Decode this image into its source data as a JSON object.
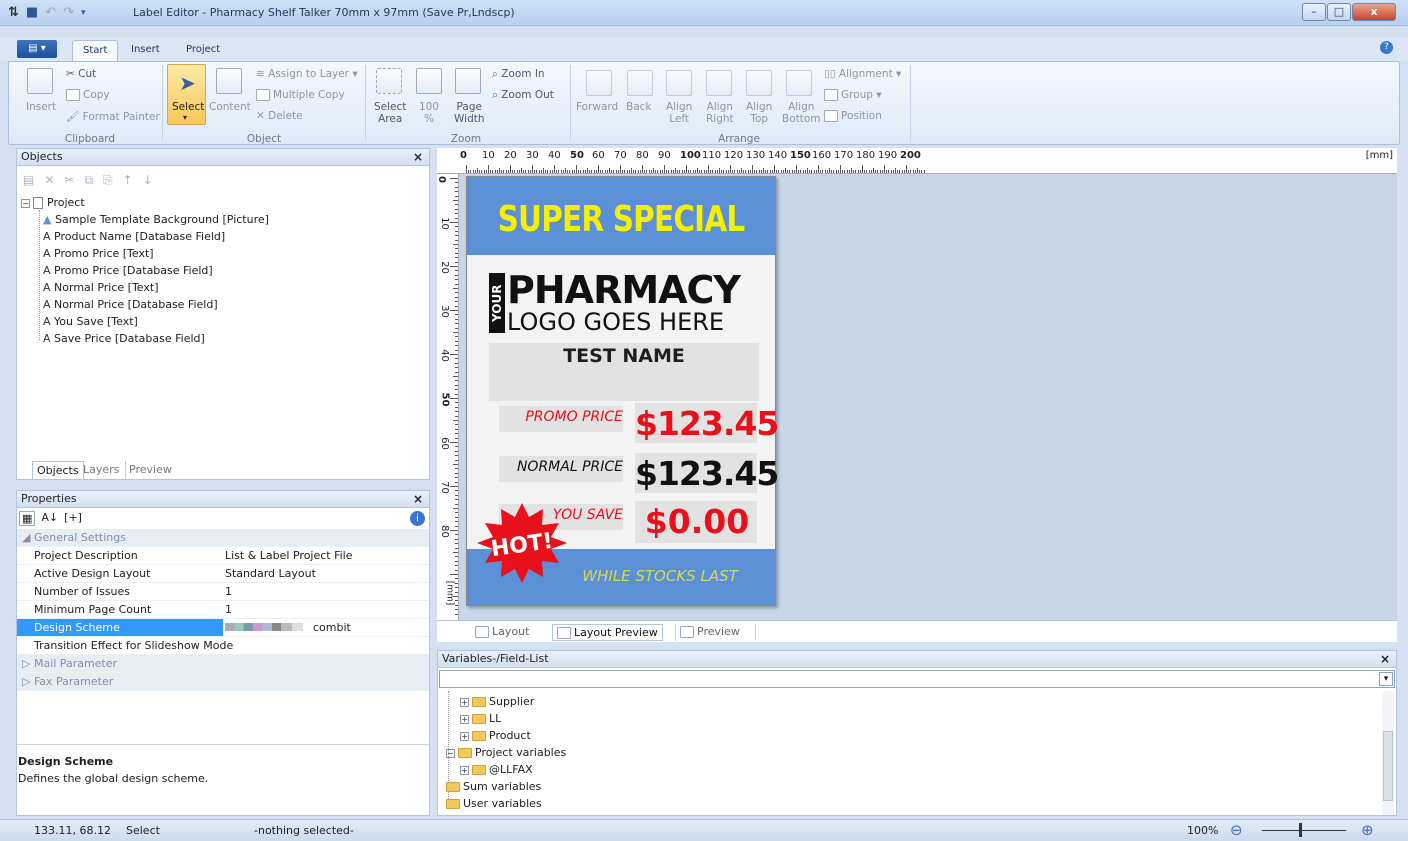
{
  "window": {
    "title": "Label Editor - Pharmacy Shelf Talker 70mm x 97mm (Save Pr,Lndscp)",
    "min": "–",
    "max": "□",
    "close": "x"
  },
  "ribbon": {
    "tabs": [
      "Start",
      "Insert",
      "Project"
    ],
    "clipboard": {
      "cut": "Cut",
      "copy": "Copy",
      "insert": "Insert",
      "format_painter": "Format Painter",
      "group": "Clipboard"
    },
    "object": {
      "select": "Select",
      "content": "Content",
      "assign_to_layer": "Assign to Layer",
      "multiple_copy": "Multiple Copy",
      "delete": "Delete",
      "group": "Object"
    },
    "zoom": {
      "select_area_1": "Select",
      "select_area_2": "Area",
      "z100_1": "100",
      "z100_2": "%",
      "page_width_1": "Page",
      "page_width_2": "Width",
      "zoom_in": "Zoom In",
      "zoom_out": "Zoom Out",
      "group": "Zoom"
    },
    "arrange": {
      "forward": "Forward",
      "back": "Back",
      "align_left_1": "Align",
      "align_left_2": "Left",
      "align_right_1": "Align",
      "align_right_2": "Right",
      "align_top_1": "Align",
      "align_top_2": "Top",
      "align_bottom_1": "Align",
      "align_bottom_2": "Bottom",
      "alignment": "Alignment",
      "group_btn": "Group",
      "position": "Position",
      "group": "Arrange"
    }
  },
  "objects_panel": {
    "title": "Objects",
    "root": "Project",
    "items": [
      "Sample Template Background [Picture]",
      "Product Name [Database Field]",
      "Promo Price [Text]",
      "Promo Price [Database Field]",
      "Normal Price [Text]",
      "Normal Price [Database Field]",
      "You Save [Text]",
      "Save Price [Database Field]"
    ],
    "tabs": [
      "Objects",
      "Layers",
      "Preview"
    ]
  },
  "properties_panel": {
    "title": "Properties",
    "group_general": "General Settings",
    "rows": [
      {
        "key": "Project Description",
        "value": "List & Label Project File"
      },
      {
        "key": "Active Design Layout",
        "value": "Standard Layout"
      },
      {
        "key": "Number of Issues",
        "value": "1"
      },
      {
        "key": "Minimum Page Count",
        "value": "1"
      },
      {
        "key": "Design Scheme",
        "value": "combit"
      },
      {
        "key": "Transition Effect for Slideshow Mode",
        "value": ""
      }
    ],
    "group_mail": "Mail Parameter",
    "group_fax": "Fax Parameter",
    "desc_title": "Design Scheme",
    "desc_text": "Defines the global design scheme."
  },
  "ruler": {
    "top": [
      "0",
      "10",
      "20",
      "30",
      "40",
      "50",
      "60",
      "70",
      "80",
      "90",
      "100",
      "110",
      "120",
      "130",
      "140",
      "150",
      "160",
      "170",
      "180",
      "190",
      "200"
    ],
    "unit": "[mm]",
    "left": [
      "0",
      "10",
      "20",
      "30",
      "40",
      "50",
      "60",
      "70",
      "80"
    ],
    "left_unit": "[mm]"
  },
  "label": {
    "header": "SUPER SPECIAL",
    "logo_vertical": "YOUR",
    "logo_main": "PHARMACY",
    "logo_sub": "LOGO GOES HERE",
    "product": "TEST NAME",
    "promo_label": "PROMO PRICE",
    "promo_price": "$123.45",
    "normal_label": "NORMAL PRICE",
    "normal_price": "$123.45",
    "save_label": "YOU SAVE",
    "save_price": "$0.00",
    "hot": "HOT!",
    "footer": "WHILE STOCKS LAST",
    "colors": {
      "blue": "#5b8fd6",
      "yellow": "#f5f000",
      "red": "#e8101b",
      "footer_text": "#ddd84a"
    }
  },
  "view_tabs": [
    "Layout",
    "Layout Preview",
    "Preview"
  ],
  "variables_panel": {
    "title": "Variables-/Field-List",
    "items": [
      {
        "label": "Supplier",
        "indent": 1
      },
      {
        "label": "LL",
        "indent": 1
      },
      {
        "label": "Product",
        "indent": 1
      },
      {
        "label": "Project variables",
        "indent": 0
      },
      {
        "label": "@LLFAX",
        "indent": 1
      },
      {
        "label": "Sum variables",
        "indent": 0
      },
      {
        "label": "User variables",
        "indent": 0
      }
    ]
  },
  "status": {
    "coords": "133.11, 68.12",
    "mode": "Select",
    "selection": "-nothing selected-",
    "zoom": "100%"
  }
}
